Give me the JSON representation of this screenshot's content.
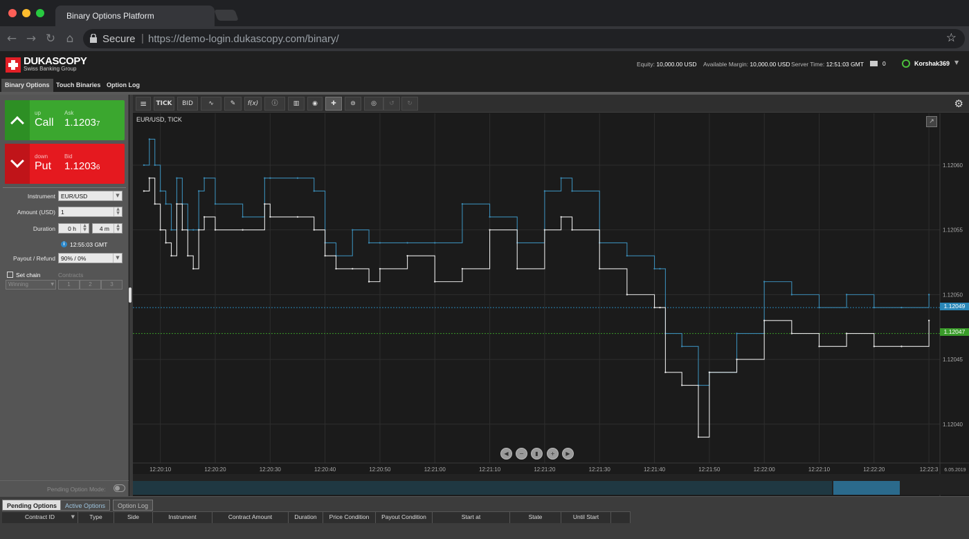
{
  "browser": {
    "tab_title": "Binary Options Platform",
    "secure_label": "Secure",
    "url": "https://demo-login.dukascopy.com/binary/",
    "nav_icons": [
      "back-icon",
      "forward-icon",
      "reload-icon",
      "home-icon"
    ],
    "star_icon": "bookmark-star-icon"
  },
  "header": {
    "logo_name": "DUKASCOPY",
    "logo_sub": "Swiss Banking Group",
    "equity_label": "Equity:",
    "equity_value": "10,000.00 USD",
    "margin_label": "Available Margin:",
    "margin_value": "10,000.00 USD",
    "server_label": "Server Time:",
    "server_value": "12:51:03 GMT",
    "messages_count": "0",
    "username": "Korshak369"
  },
  "main_nav": {
    "tabs": [
      {
        "label": "Binary Options",
        "active": true
      },
      {
        "label": "Touch Binaries",
        "active": false
      },
      {
        "label": "Option Log",
        "active": false
      }
    ]
  },
  "trade": {
    "call": {
      "direction": "up",
      "label": "Call",
      "price_label": "Ask",
      "price_main": "1.1203",
      "price_pip": "7"
    },
    "put": {
      "direction": "down",
      "label": "Put",
      "price_label": "Bid",
      "price_main": "1.1203",
      "price_pip": "6"
    }
  },
  "form": {
    "instrument_label": "Instrument",
    "instrument_value": "EUR/USD",
    "amount_label": "Amount (USD)",
    "amount_value": "1",
    "duration_label": "Duration",
    "duration_hours": "0 h",
    "duration_minutes": "4 m",
    "expiry_time": "12:55:03 GMT",
    "payout_label": "Payout / Refund",
    "payout_value": "90% / 0%",
    "set_chain_label": "Set chain",
    "contracts_label": "Contracts",
    "winning_value": "Winning",
    "contract_options": [
      "1",
      "2",
      "3"
    ],
    "pending_mode_label": "Pending Option Mode:"
  },
  "chart": {
    "symbol_label": "EUR/USD, TICK",
    "toolbar": {
      "period": "TICK",
      "side": "BID"
    },
    "price_labels": [
      "1.12060",
      "1.12055",
      "1.12050",
      "1.12045",
      "1.12040"
    ],
    "ask_tag": "1.12049",
    "bid_tag": "1.12047",
    "ask_color": "#2a87b8",
    "bid_color": "#3a9c2a",
    "time_labels": [
      "12:20:10",
      "12:20:20",
      "12:20:30",
      "12:20:40",
      "12:20:50",
      "12:21:00",
      "12:21:10",
      "12:21:20",
      "12:21:30",
      "12:21:40",
      "12:21:50",
      "12:22:00",
      "12:22:10",
      "12:22:20",
      "12:22:3"
    ],
    "date_label": "6.05.2019"
  },
  "chart_data": {
    "type": "line",
    "xlabel": "",
    "ylabel": "",
    "ylim": [
      1.12037,
      1.12064
    ],
    "series": [
      {
        "color": "#3a8bb5",
        "x": [
          "12:20:07",
          "12:20:08",
          "12:20:09",
          "12:20:10",
          "12:20:11",
          "12:20:12",
          "12:20:13",
          "12:20:14",
          "12:20:15",
          "12:20:16",
          "12:20:17",
          "12:20:18",
          "12:20:20",
          "12:20:25",
          "12:20:29",
          "12:20:30",
          "12:20:35",
          "12:20:38",
          "12:20:40",
          "12:20:42",
          "12:20:45",
          "12:20:48",
          "12:20:50",
          "12:20:55",
          "12:21:00",
          "12:21:05",
          "12:21:10",
          "12:21:15",
          "12:21:20",
          "12:21:23",
          "12:21:25",
          "12:21:30",
          "12:21:35",
          "12:21:40",
          "12:21:41",
          "12:21:42",
          "12:21:45",
          "12:21:48",
          "12:21:50",
          "12:21:55",
          "12:22:00",
          "12:22:05",
          "12:22:10",
          "12:22:15",
          "12:22:20",
          "12:22:25",
          "12:22:30"
        ],
        "values": [
          1.1206,
          1.12062,
          1.1206,
          1.12058,
          1.12057,
          1.12055,
          1.12059,
          1.12057,
          1.12055,
          1.12055,
          1.12058,
          1.12059,
          1.12057,
          1.12056,
          1.12059,
          1.12059,
          1.12059,
          1.12058,
          1.12054,
          1.12053,
          1.12055,
          1.12054,
          1.12054,
          1.12054,
          1.12054,
          1.12057,
          1.12056,
          1.12054,
          1.12058,
          1.12059,
          1.12058,
          1.12054,
          1.12053,
          1.12052,
          1.12052,
          1.12047,
          1.12046,
          1.12043,
          1.12044,
          1.12047,
          1.12051,
          1.1205,
          1.12049,
          1.1205,
          1.12049,
          1.12049,
          1.1205
        ]
      },
      {
        "color": "#e6e6e6",
        "x": [
          "12:20:07",
          "12:20:08",
          "12:20:09",
          "12:20:10",
          "12:20:11",
          "12:20:12",
          "12:20:13",
          "12:20:14",
          "12:20:15",
          "12:20:16",
          "12:20:17",
          "12:20:18",
          "12:20:20",
          "12:20:25",
          "12:20:29",
          "12:20:30",
          "12:20:35",
          "12:20:38",
          "12:20:40",
          "12:20:42",
          "12:20:45",
          "12:20:48",
          "12:20:50",
          "12:20:55",
          "12:21:00",
          "12:21:05",
          "12:21:10",
          "12:21:15",
          "12:21:20",
          "12:21:23",
          "12:21:25",
          "12:21:30",
          "12:21:35",
          "12:21:40",
          "12:21:41",
          "12:21:42",
          "12:21:45",
          "12:21:48",
          "12:21:50",
          "12:21:55",
          "12:22:00",
          "12:22:05",
          "12:22:10",
          "12:22:15",
          "12:22:20",
          "12:22:25",
          "12:22:30"
        ],
        "values": [
          1.12058,
          1.12059,
          1.12057,
          1.12055,
          1.12054,
          1.12053,
          1.12057,
          1.12055,
          1.12053,
          1.12052,
          1.12055,
          1.12056,
          1.12055,
          1.12055,
          1.12057,
          1.12056,
          1.12056,
          1.12055,
          1.12053,
          1.12052,
          1.12052,
          1.12051,
          1.12052,
          1.12053,
          1.12051,
          1.12052,
          1.12055,
          1.12052,
          1.12055,
          1.12056,
          1.12055,
          1.12052,
          1.1205,
          1.12049,
          1.12049,
          1.12044,
          1.12043,
          1.12039,
          1.12044,
          1.12045,
          1.12048,
          1.12047,
          1.12046,
          1.12047,
          1.12046,
          1.12046,
          1.12048
        ]
      }
    ]
  },
  "bottom": {
    "tabs": [
      {
        "label": "Pending Options",
        "active": true
      },
      {
        "label": "Active Options",
        "active": false
      },
      {
        "label": "Option Log",
        "active": false
      }
    ],
    "columns": [
      "Contract ID",
      "Type",
      "Side",
      "Instrument",
      "Contract Amount",
      "Duration",
      "Price Condition",
      "Payout Condition",
      "Start at",
      "State",
      "Until Start"
    ]
  }
}
